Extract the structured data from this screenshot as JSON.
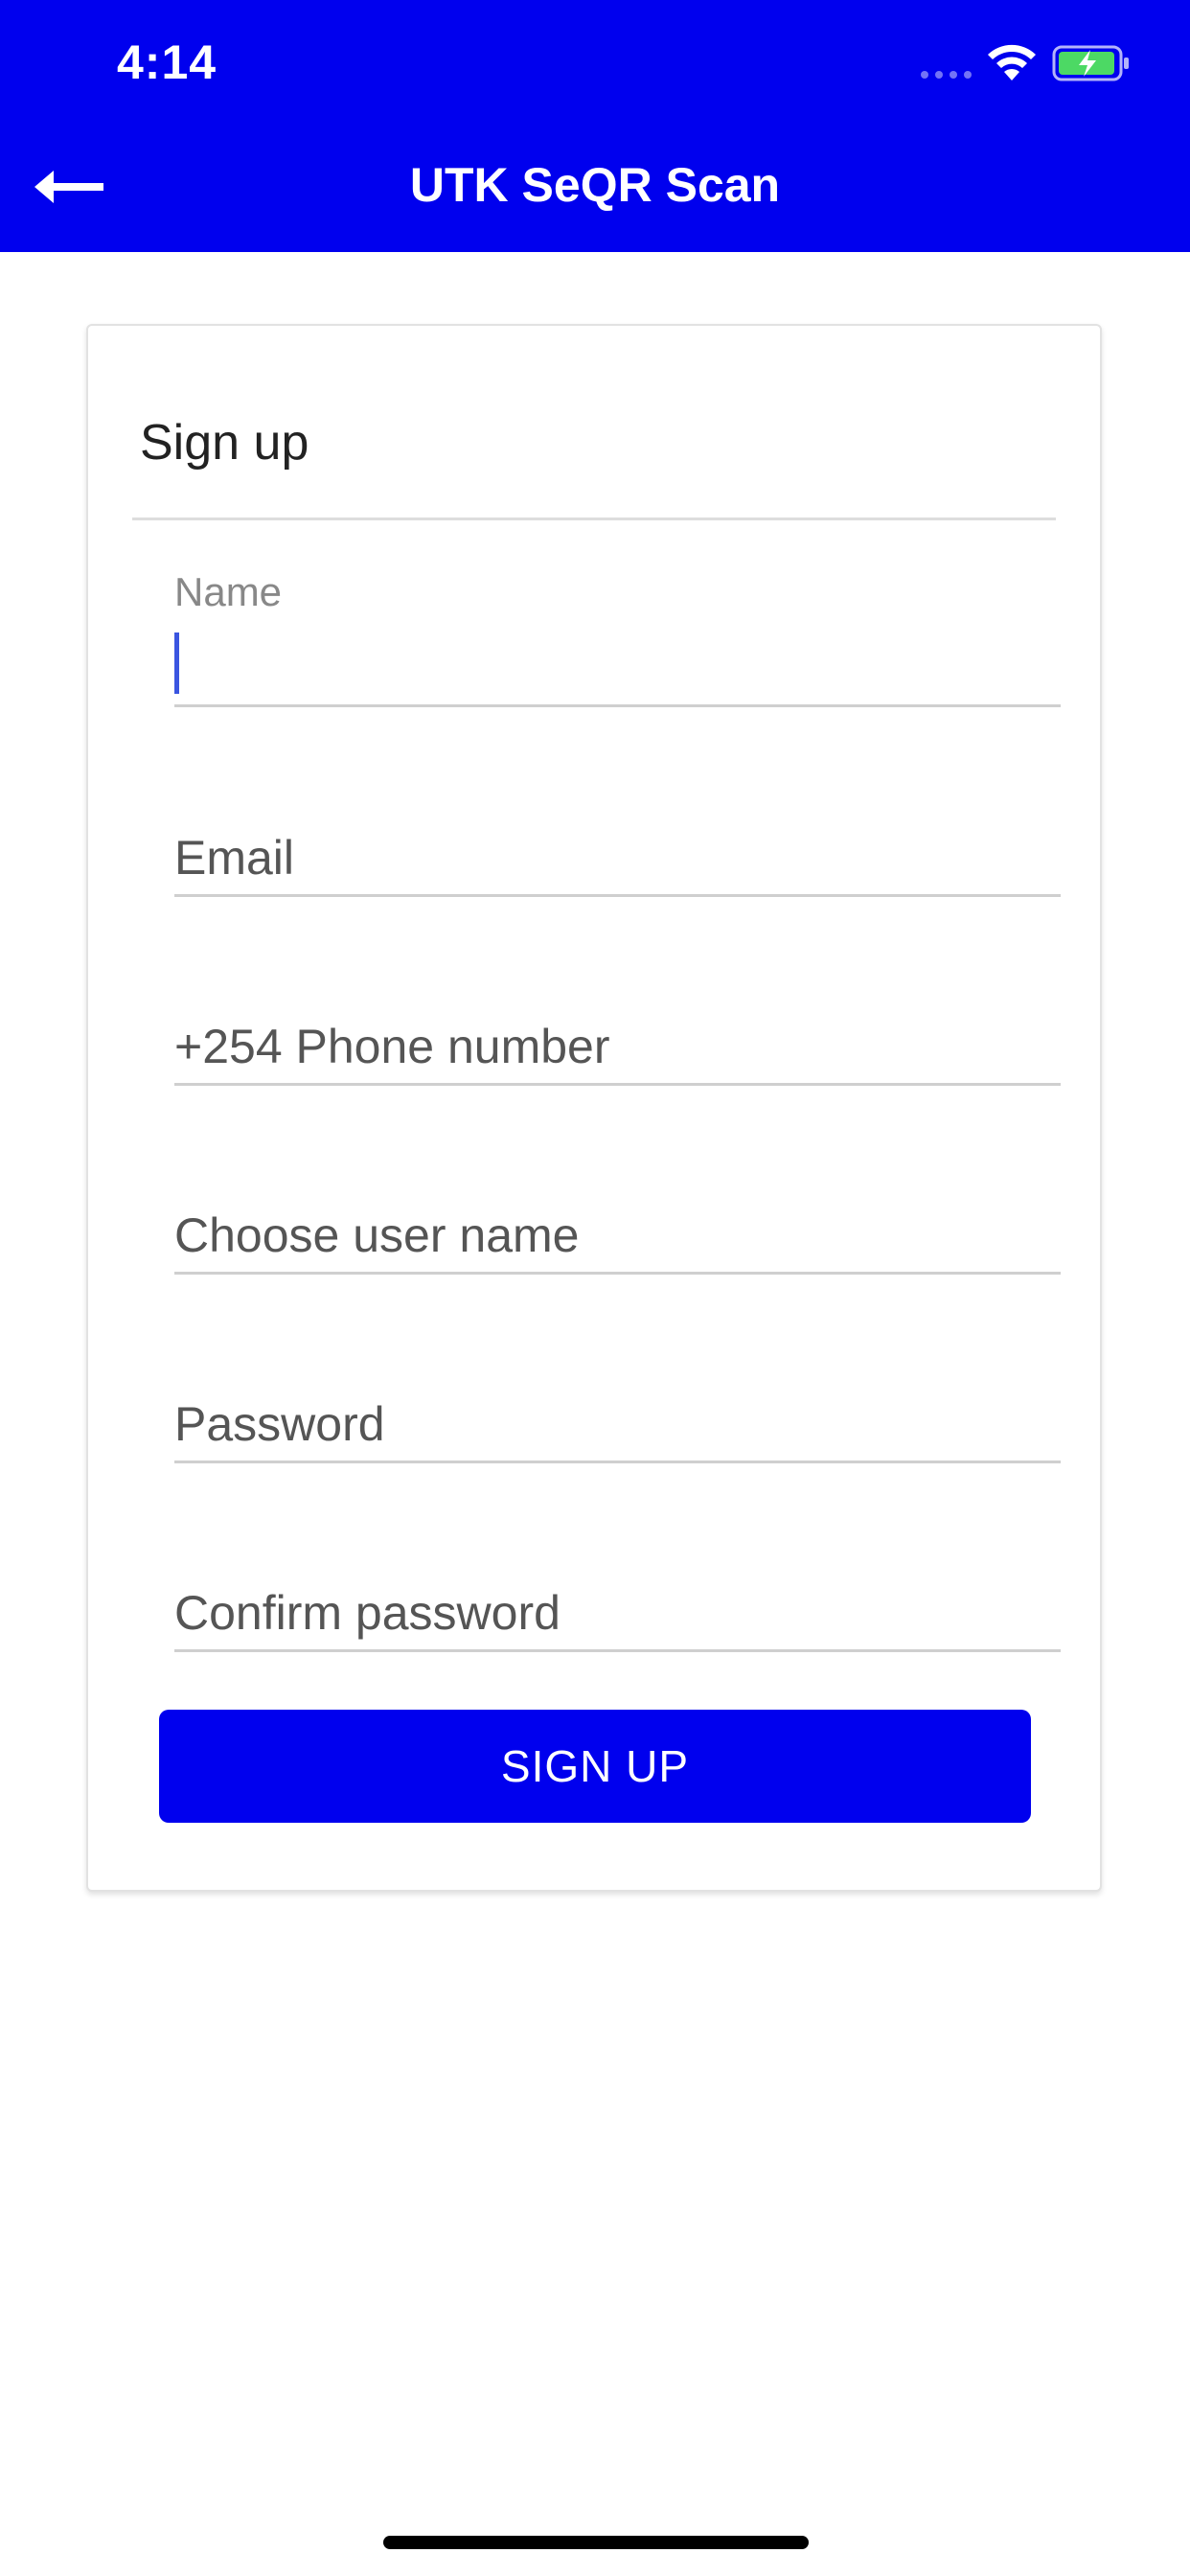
{
  "status_bar": {
    "time": "4:14",
    "icons": [
      "signal-dots-icon",
      "wifi-icon",
      "battery-charging-icon"
    ],
    "battery_color": "#4cd964"
  },
  "nav": {
    "title": "UTK SeQR Scan",
    "back_icon": "back-arrow-icon"
  },
  "form": {
    "title": "Sign up",
    "fields": [
      {
        "label": "Name",
        "value": ""
      },
      {
        "placeholder": "Email",
        "value": ""
      },
      {
        "placeholder": "+254 Phone number",
        "value": ""
      },
      {
        "placeholder": "Choose user name",
        "value": ""
      },
      {
        "placeholder": "Password",
        "value": ""
      },
      {
        "placeholder": "Confirm password",
        "value": ""
      }
    ],
    "submit_label": "SIGN UP"
  },
  "colors": {
    "primary": "#0000ee",
    "caret": "#3a55e0"
  }
}
